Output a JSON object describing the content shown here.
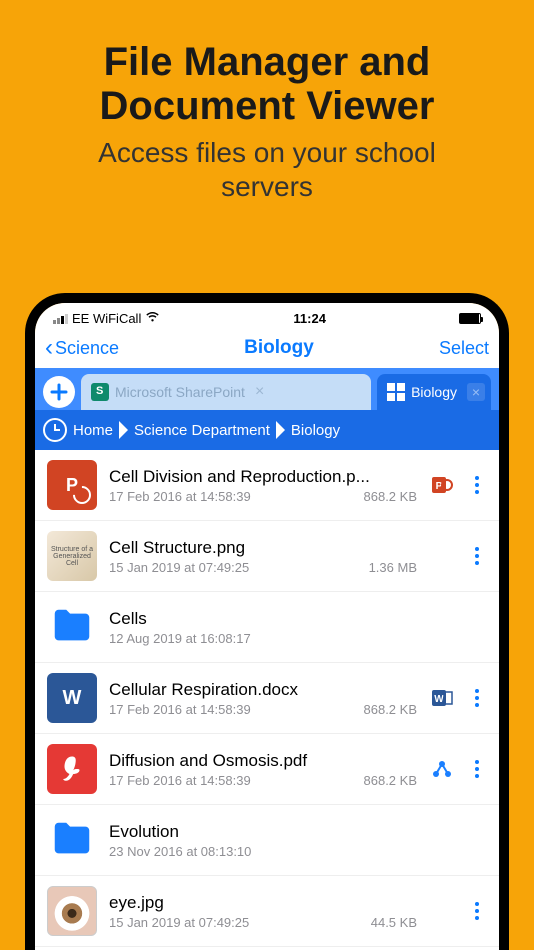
{
  "promo": {
    "title_line1": "File Manager and",
    "title_line2": "Document Viewer",
    "subtitle_line1": "Access files on your school",
    "subtitle_line2": "servers"
  },
  "status": {
    "carrier": "EE WiFiCall",
    "time": "11:24"
  },
  "nav": {
    "back_label": "Science",
    "title": "Biology",
    "select_label": "Select"
  },
  "tabs": {
    "inactive": {
      "label": "Microsoft SharePoint"
    },
    "active": {
      "label": "Biology"
    }
  },
  "breadcrumb": {
    "items": [
      "Home",
      "Science Department",
      "Biology"
    ]
  },
  "files": [
    {
      "name": "Cell Division and Reproduction.p...",
      "date": "17 Feb 2016 at 14:58:39",
      "size": "868.2 KB",
      "type": "ppt"
    },
    {
      "name": "Cell Structure.png",
      "date": "15 Jan 2019 at 07:49:25",
      "size": "1.36 MB",
      "type": "image-cell"
    },
    {
      "name": "Cells",
      "date": "12 Aug 2019 at 16:08:17",
      "size": "",
      "type": "folder"
    },
    {
      "name": "Cellular Respiration.docx",
      "date": "17 Feb 2016 at 14:58:39",
      "size": "868.2 KB",
      "type": "word"
    },
    {
      "name": "Diffusion and Osmosis.pdf",
      "date": "17 Feb 2016 at 14:58:39",
      "size": "868.2 KB",
      "type": "pdf"
    },
    {
      "name": "Evolution",
      "date": "23 Nov 2016 at 08:13:10",
      "size": "",
      "type": "folder"
    },
    {
      "name": "eye.jpg",
      "date": "15 Jan 2019 at 07:49:25",
      "size": "44.5 KB",
      "type": "image-eye"
    }
  ]
}
